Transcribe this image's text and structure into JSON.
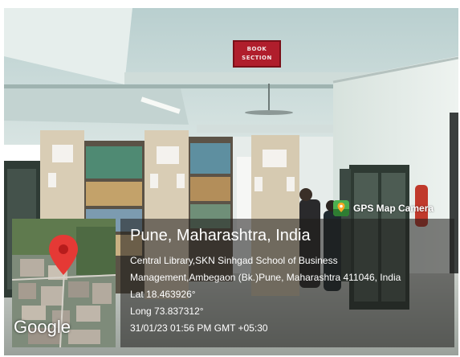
{
  "photo": {
    "sign_lines": [
      "BOOK",
      "SECTION"
    ]
  },
  "watermark": {
    "app_label": "GPS Map Camera",
    "app_icon": "gps-map-camera-icon",
    "map_attribution": "Google",
    "location_title": "Pune, Maharashtra, India",
    "address_line1": "Central Library,SKN Sinhgad School of Business",
    "address_line2": "Management,Ambegaon (Bk.)Pune, Maharashtra 411046, India",
    "latitude": "Lat 18.463926°",
    "longitude": "Long 73.837312°",
    "timestamp": "31/01/23 01:56 PM GMT +05:30"
  },
  "colors": {
    "panel_overlay": "#1e1c1a",
    "pin": "#e53935",
    "sign": "#b01e2c"
  }
}
